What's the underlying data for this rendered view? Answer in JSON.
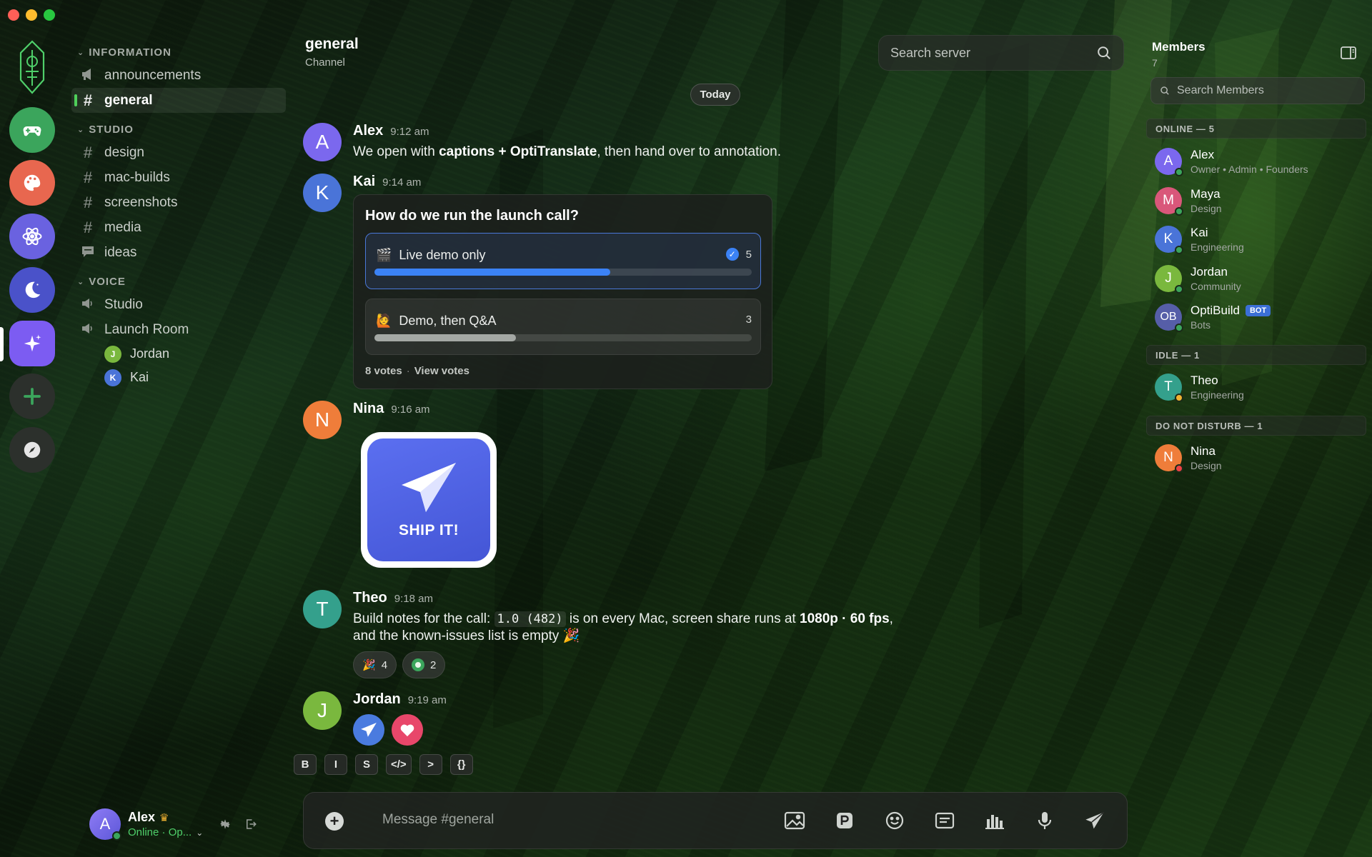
{
  "window": {
    "traffic_colors": [
      "#ff5f57",
      "#febc2e",
      "#28c840"
    ]
  },
  "servers": [
    {
      "name": "game-controller-icon",
      "color": "#3ba55c"
    },
    {
      "name": "palette-icon",
      "color": "#e8674f"
    },
    {
      "name": "atom-icon",
      "color": "#6a62e0"
    },
    {
      "name": "moon-icon",
      "color": "#4a52c9"
    },
    {
      "name": "sparkle-icon",
      "color": "#7c5cf2"
    },
    {
      "name": "add-server-icon",
      "color": "#2c302c"
    },
    {
      "name": "compass-icon",
      "color": "#2c302c"
    }
  ],
  "sidebar": {
    "categories": {
      "information": "INFORMATION",
      "studio": "STUDIO",
      "voice": "VOICE"
    },
    "info_channels": [
      "announcements",
      "general"
    ],
    "studio_channels": [
      "design",
      "mac-builds",
      "screenshots",
      "media",
      "ideas"
    ],
    "voice_channels": [
      "Studio",
      "Launch Room"
    ],
    "voice_members": [
      {
        "initial": "J",
        "name": "Jordan",
        "color": "#7ab83e"
      },
      {
        "initial": "K",
        "name": "Kai",
        "color": "#4a74d8"
      }
    ]
  },
  "user": {
    "initial": "A",
    "name": "Alex",
    "status": "Online · Op..."
  },
  "header": {
    "title": "general",
    "subtitle": "Channel",
    "search_placeholder": "Search server"
  },
  "day_divider": "Today",
  "messages": {
    "alex": {
      "initial": "A",
      "name": "Alex",
      "time": "9:12 am",
      "color": "#7b68ee",
      "text_pre": "We open with ",
      "text_bold": "captions + OptiTranslate",
      "text_post": ", then hand over to annotation."
    },
    "kai": {
      "initial": "K",
      "name": "Kai",
      "time": "9:14 am",
      "color": "#4a74d8"
    },
    "nina": {
      "initial": "N",
      "name": "Nina",
      "time": "9:16 am",
      "color": "#ef7d3a"
    },
    "theo": {
      "initial": "T",
      "name": "Theo",
      "time": "9:18 am",
      "color": "#34a08c",
      "line1_pre": "Build notes for the call: ",
      "line1_code": "1.0 (482)",
      "line1_mid": " is on every Mac, screen share runs at ",
      "line1_bold": "1080p · 60 fps",
      "line1_post": ",",
      "line2": "and the known-issues list is empty 🎉"
    },
    "jordan": {
      "initial": "J",
      "name": "Jordan",
      "time": "9:19 am",
      "color": "#7ab83e"
    }
  },
  "poll": {
    "question": "How do we run the launch call?",
    "options": [
      {
        "emoji": "🎬",
        "label": "Live demo only",
        "votes": "5",
        "fraction": 0.625,
        "selected": true
      },
      {
        "emoji": "🙋",
        "label": "Demo, then Q&A",
        "votes": "3",
        "fraction": 0.375,
        "selected": false
      }
    ],
    "total": "8 votes",
    "view": "View votes"
  },
  "sticker": {
    "text": "SHIP IT!"
  },
  "reactions": [
    {
      "emoji": "🎉",
      "count": "4"
    },
    {
      "emoji": "🟢",
      "count": "2"
    }
  ],
  "format_buttons": [
    "B",
    "I",
    "S",
    "</>",
    ">",
    "{}"
  ],
  "composer": {
    "placeholder": "Message #general"
  },
  "members": {
    "title": "Members",
    "count": "7",
    "search_placeholder": "Search Members",
    "groups": {
      "online": "ONLINE — 5",
      "idle": "IDLE — 1",
      "dnd": "DO NOT DISTURB — 1"
    },
    "list": [
      {
        "initial": "A",
        "name": "Alex",
        "role": "Owner • Admin • Founders",
        "color": "#7b68ee",
        "status": "#3ba55c"
      },
      {
        "initial": "M",
        "name": "Maya",
        "role": "Design",
        "color": "#d9577a",
        "status": "#3ba55c"
      },
      {
        "initial": "K",
        "name": "Kai",
        "role": "Engineering",
        "color": "#4a74d8",
        "status": "#3ba55c"
      },
      {
        "initial": "J",
        "name": "Jordan",
        "role": "Community",
        "color": "#7ab83e",
        "status": "#3ba55c"
      },
      {
        "initial": "OB",
        "name": "OptiBuild",
        "role": "Bots",
        "color": "#565ea8",
        "status": "#3ba55c",
        "badge": "BOT"
      },
      {
        "initial": "T",
        "name": "Theo",
        "role": "Engineering",
        "color": "#34a08c",
        "status": "#f0b232"
      },
      {
        "initial": "N",
        "name": "Nina",
        "role": "Design",
        "color": "#ef7d3a",
        "status": "#ed4245"
      }
    ]
  }
}
